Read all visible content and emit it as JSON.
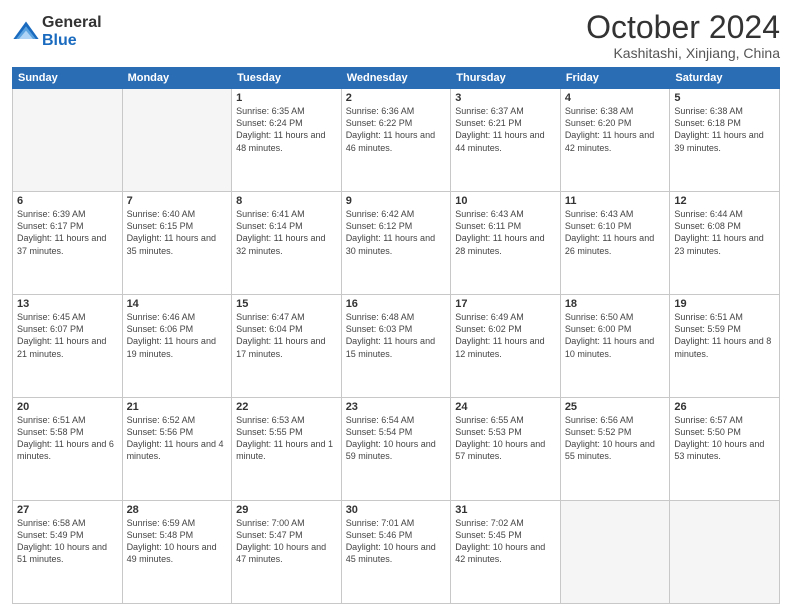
{
  "logo": {
    "general": "General",
    "blue": "Blue"
  },
  "title": "October 2024",
  "location": "Kashitashi, Xinjiang, China",
  "days_of_week": [
    "Sunday",
    "Monday",
    "Tuesday",
    "Wednesday",
    "Thursday",
    "Friday",
    "Saturday"
  ],
  "weeks": [
    [
      {
        "day": "",
        "sunrise": "",
        "sunset": "",
        "daylight": "",
        "empty": true
      },
      {
        "day": "",
        "sunrise": "",
        "sunset": "",
        "daylight": "",
        "empty": true
      },
      {
        "day": "1",
        "sunrise": "Sunrise: 6:35 AM",
        "sunset": "Sunset: 6:24 PM",
        "daylight": "Daylight: 11 hours and 48 minutes.",
        "empty": false
      },
      {
        "day": "2",
        "sunrise": "Sunrise: 6:36 AM",
        "sunset": "Sunset: 6:22 PM",
        "daylight": "Daylight: 11 hours and 46 minutes.",
        "empty": false
      },
      {
        "day": "3",
        "sunrise": "Sunrise: 6:37 AM",
        "sunset": "Sunset: 6:21 PM",
        "daylight": "Daylight: 11 hours and 44 minutes.",
        "empty": false
      },
      {
        "day": "4",
        "sunrise": "Sunrise: 6:38 AM",
        "sunset": "Sunset: 6:20 PM",
        "daylight": "Daylight: 11 hours and 42 minutes.",
        "empty": false
      },
      {
        "day": "5",
        "sunrise": "Sunrise: 6:38 AM",
        "sunset": "Sunset: 6:18 PM",
        "daylight": "Daylight: 11 hours and 39 minutes.",
        "empty": false
      }
    ],
    [
      {
        "day": "6",
        "sunrise": "Sunrise: 6:39 AM",
        "sunset": "Sunset: 6:17 PM",
        "daylight": "Daylight: 11 hours and 37 minutes.",
        "empty": false
      },
      {
        "day": "7",
        "sunrise": "Sunrise: 6:40 AM",
        "sunset": "Sunset: 6:15 PM",
        "daylight": "Daylight: 11 hours and 35 minutes.",
        "empty": false
      },
      {
        "day": "8",
        "sunrise": "Sunrise: 6:41 AM",
        "sunset": "Sunset: 6:14 PM",
        "daylight": "Daylight: 11 hours and 32 minutes.",
        "empty": false
      },
      {
        "day": "9",
        "sunrise": "Sunrise: 6:42 AM",
        "sunset": "Sunset: 6:12 PM",
        "daylight": "Daylight: 11 hours and 30 minutes.",
        "empty": false
      },
      {
        "day": "10",
        "sunrise": "Sunrise: 6:43 AM",
        "sunset": "Sunset: 6:11 PM",
        "daylight": "Daylight: 11 hours and 28 minutes.",
        "empty": false
      },
      {
        "day": "11",
        "sunrise": "Sunrise: 6:43 AM",
        "sunset": "Sunset: 6:10 PM",
        "daylight": "Daylight: 11 hours and 26 minutes.",
        "empty": false
      },
      {
        "day": "12",
        "sunrise": "Sunrise: 6:44 AM",
        "sunset": "Sunset: 6:08 PM",
        "daylight": "Daylight: 11 hours and 23 minutes.",
        "empty": false
      }
    ],
    [
      {
        "day": "13",
        "sunrise": "Sunrise: 6:45 AM",
        "sunset": "Sunset: 6:07 PM",
        "daylight": "Daylight: 11 hours and 21 minutes.",
        "empty": false
      },
      {
        "day": "14",
        "sunrise": "Sunrise: 6:46 AM",
        "sunset": "Sunset: 6:06 PM",
        "daylight": "Daylight: 11 hours and 19 minutes.",
        "empty": false
      },
      {
        "day": "15",
        "sunrise": "Sunrise: 6:47 AM",
        "sunset": "Sunset: 6:04 PM",
        "daylight": "Daylight: 11 hours and 17 minutes.",
        "empty": false
      },
      {
        "day": "16",
        "sunrise": "Sunrise: 6:48 AM",
        "sunset": "Sunset: 6:03 PM",
        "daylight": "Daylight: 11 hours and 15 minutes.",
        "empty": false
      },
      {
        "day": "17",
        "sunrise": "Sunrise: 6:49 AM",
        "sunset": "Sunset: 6:02 PM",
        "daylight": "Daylight: 11 hours and 12 minutes.",
        "empty": false
      },
      {
        "day": "18",
        "sunrise": "Sunrise: 6:50 AM",
        "sunset": "Sunset: 6:00 PM",
        "daylight": "Daylight: 11 hours and 10 minutes.",
        "empty": false
      },
      {
        "day": "19",
        "sunrise": "Sunrise: 6:51 AM",
        "sunset": "Sunset: 5:59 PM",
        "daylight": "Daylight: 11 hours and 8 minutes.",
        "empty": false
      }
    ],
    [
      {
        "day": "20",
        "sunrise": "Sunrise: 6:51 AM",
        "sunset": "Sunset: 5:58 PM",
        "daylight": "Daylight: 11 hours and 6 minutes.",
        "empty": false
      },
      {
        "day": "21",
        "sunrise": "Sunrise: 6:52 AM",
        "sunset": "Sunset: 5:56 PM",
        "daylight": "Daylight: 11 hours and 4 minutes.",
        "empty": false
      },
      {
        "day": "22",
        "sunrise": "Sunrise: 6:53 AM",
        "sunset": "Sunset: 5:55 PM",
        "daylight": "Daylight: 11 hours and 1 minute.",
        "empty": false
      },
      {
        "day": "23",
        "sunrise": "Sunrise: 6:54 AM",
        "sunset": "Sunset: 5:54 PM",
        "daylight": "Daylight: 10 hours and 59 minutes.",
        "empty": false
      },
      {
        "day": "24",
        "sunrise": "Sunrise: 6:55 AM",
        "sunset": "Sunset: 5:53 PM",
        "daylight": "Daylight: 10 hours and 57 minutes.",
        "empty": false
      },
      {
        "day": "25",
        "sunrise": "Sunrise: 6:56 AM",
        "sunset": "Sunset: 5:52 PM",
        "daylight": "Daylight: 10 hours and 55 minutes.",
        "empty": false
      },
      {
        "day": "26",
        "sunrise": "Sunrise: 6:57 AM",
        "sunset": "Sunset: 5:50 PM",
        "daylight": "Daylight: 10 hours and 53 minutes.",
        "empty": false
      }
    ],
    [
      {
        "day": "27",
        "sunrise": "Sunrise: 6:58 AM",
        "sunset": "Sunset: 5:49 PM",
        "daylight": "Daylight: 10 hours and 51 minutes.",
        "empty": false
      },
      {
        "day": "28",
        "sunrise": "Sunrise: 6:59 AM",
        "sunset": "Sunset: 5:48 PM",
        "daylight": "Daylight: 10 hours and 49 minutes.",
        "empty": false
      },
      {
        "day": "29",
        "sunrise": "Sunrise: 7:00 AM",
        "sunset": "Sunset: 5:47 PM",
        "daylight": "Daylight: 10 hours and 47 minutes.",
        "empty": false
      },
      {
        "day": "30",
        "sunrise": "Sunrise: 7:01 AM",
        "sunset": "Sunset: 5:46 PM",
        "daylight": "Daylight: 10 hours and 45 minutes.",
        "empty": false
      },
      {
        "day": "31",
        "sunrise": "Sunrise: 7:02 AM",
        "sunset": "Sunset: 5:45 PM",
        "daylight": "Daylight: 10 hours and 42 minutes.",
        "empty": false
      },
      {
        "day": "",
        "sunrise": "",
        "sunset": "",
        "daylight": "",
        "empty": true
      },
      {
        "day": "",
        "sunrise": "",
        "sunset": "",
        "daylight": "",
        "empty": true
      }
    ]
  ]
}
